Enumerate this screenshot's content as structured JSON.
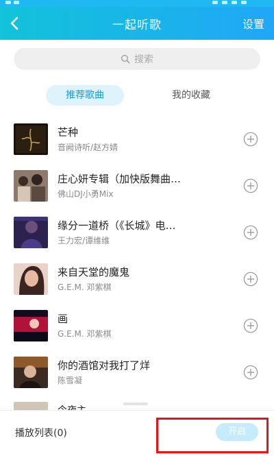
{
  "header": {
    "title": "一起听歌",
    "settings_label": "设置"
  },
  "search": {
    "placeholder": "搜索",
    "icon": "search-icon"
  },
  "tabs": [
    {
      "label": "推荐歌曲",
      "active": true
    },
    {
      "label": "我的收藏",
      "active": false
    }
  ],
  "songs": [
    {
      "title": "芒种",
      "artist": "音阙诗听/赵方婧"
    },
    {
      "title": "庄心妍专辑（加快版舞曲…",
      "artist": "佛山DJ小勇Mix"
    },
    {
      "title": "缘分一道桥（《长城》电…",
      "artist": "王力宏/谭维维"
    },
    {
      "title": "来自天堂的魔鬼",
      "artist": "G.E.M. 邓紫棋"
    },
    {
      "title": "画",
      "artist": "G.E.M. 邓紫棋"
    },
    {
      "title": "你的酒馆对我打了烊",
      "artist": "陈雪凝"
    }
  ],
  "partial_song": {
    "title": "今夜主"
  },
  "footer": {
    "playlist_label": "播放列表(0)",
    "open_label": "开启"
  },
  "colors": {
    "accent": "#1fb8f3",
    "header_start": "#12c3d9",
    "header_end": "#20a7f7",
    "highlight": "#e91418"
  }
}
